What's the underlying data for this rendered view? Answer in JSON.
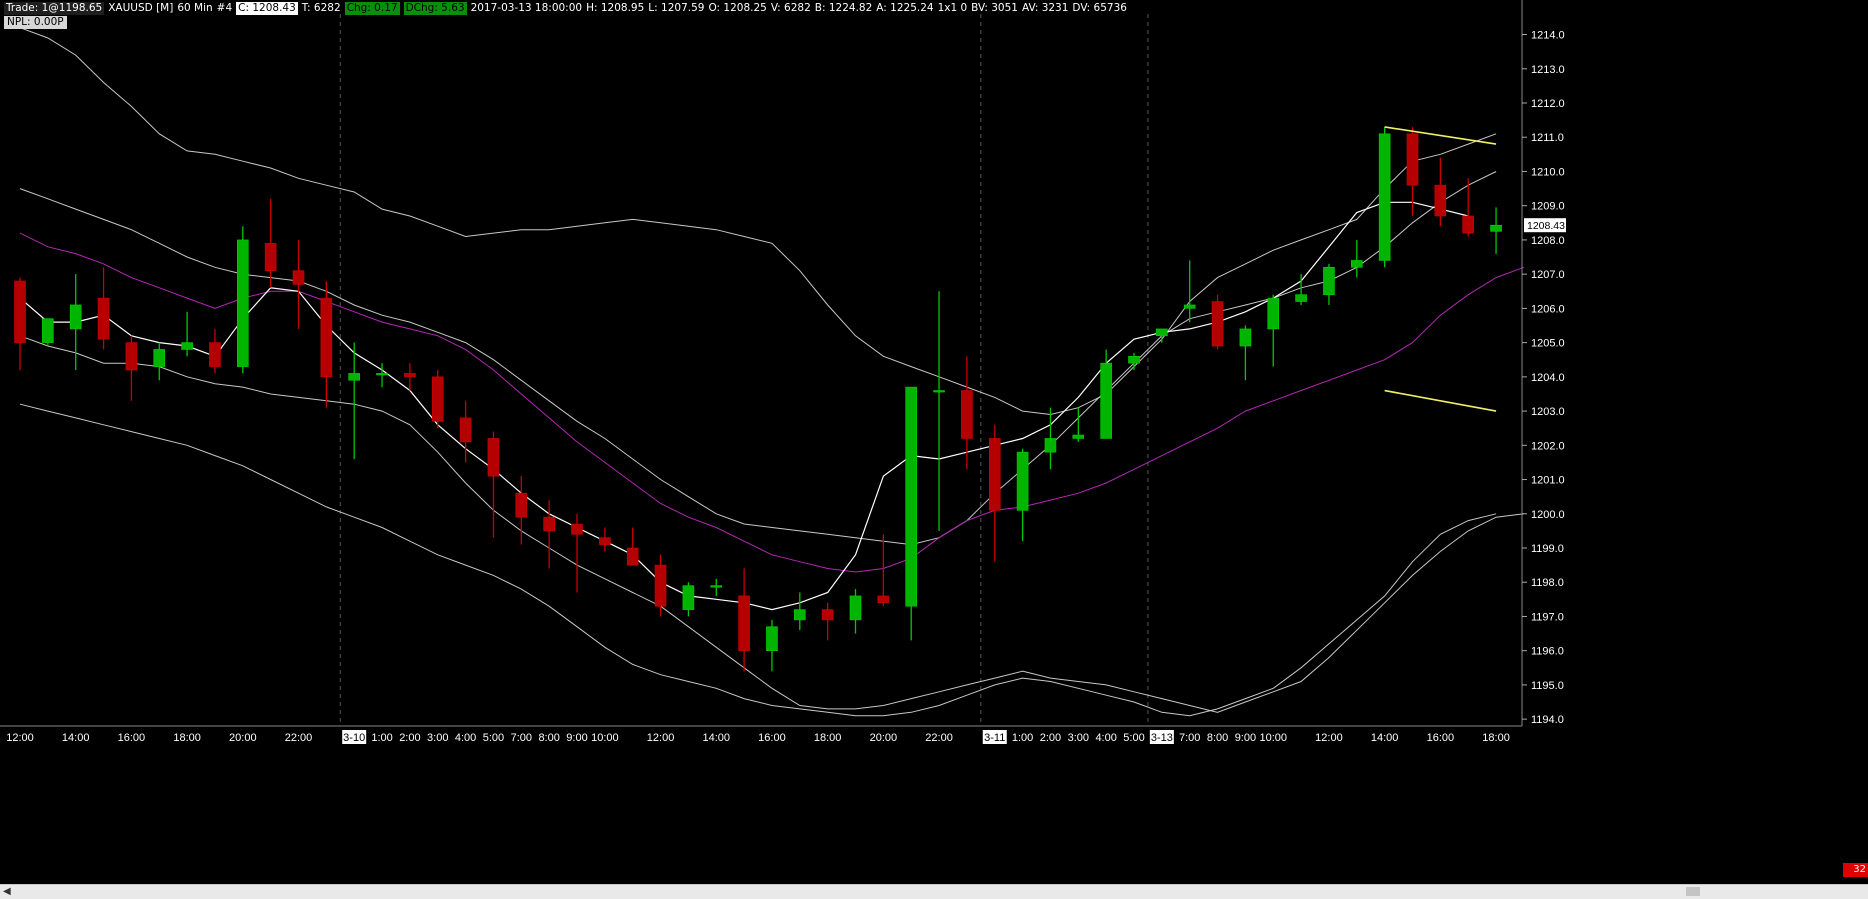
{
  "header": {
    "trade": "Trade: 1@1198.65",
    "symbol": "XAUUSD [M]",
    "interval": "60 Min",
    "bar_no": "#4",
    "close": "C: 1208.43",
    "ticks": "T: 6282",
    "chg": "Chg: 0.17",
    "dchg": "DChg: 5.63",
    "datetime": "2017-03-13 18:00:00",
    "high": "H: 1208.95",
    "low": "L: 1207.59",
    "open": "O: 1208.25",
    "volume": "V: 6282",
    "bid": "B: 1224.82",
    "ask": "A: 1225.24",
    "size": "1x1 0",
    "bv": "BV: 3051",
    "av": "AV: 3231",
    "dv": "DV: 65736"
  },
  "npl": "NPL: 0.00P",
  "corner_badge": "32",
  "colors": {
    "background": "#000000",
    "up": "#00b400",
    "down": "#b40000",
    "wick_up": "#00c800",
    "wick_down": "#c80000",
    "band": "#c8c8c8",
    "mid_line": "#b428b4",
    "trend": "#f0f064",
    "axis_text": "#ffffff",
    "current_price_box": "#ffffff"
  },
  "chart_data": {
    "type": "candlestick",
    "symbol": "XAUUSD",
    "ylim": [
      1193.8,
      1214.6
    ],
    "yticks": [
      1194,
      1195,
      1196,
      1197,
      1198,
      1199,
      1200,
      1201,
      1202,
      1203,
      1204,
      1205,
      1206,
      1207,
      1208,
      1209,
      1210,
      1211,
      1212,
      1213,
      1214
    ],
    "current_price": "1208.43",
    "xticks": [
      "12:00",
      "14:00",
      "16:00",
      "18:00",
      "20:00",
      "22:00",
      "3-10",
      "1:00",
      "2:00",
      "3:00",
      "4:00",
      "5:00",
      "7:00",
      "8:00",
      "9:00",
      "10:00",
      "12:00",
      "14:00",
      "16:00",
      "18:00",
      "20:00",
      "22:00",
      "3-11",
      "1:00",
      "2:00",
      "3:00",
      "4:00",
      "5:00",
      "3-13",
      "7:00",
      "8:00",
      "9:00",
      "10:00",
      "12:00",
      "14:00",
      "16:00",
      "18:00"
    ],
    "date_labels": [
      "3-10",
      "3-11",
      "3-13"
    ],
    "ohlc": [
      [
        1206.8,
        1206.9,
        1204.2,
        1205.0
      ],
      [
        1205.0,
        1205.7,
        1204.9,
        1205.7
      ],
      [
        1205.4,
        1207.0,
        1204.2,
        1206.1
      ],
      [
        1206.3,
        1207.2,
        1204.8,
        1205.1
      ],
      [
        1205.0,
        1205.2,
        1203.3,
        1204.2
      ],
      [
        1204.3,
        1205.0,
        1203.9,
        1204.8
      ],
      [
        1204.8,
        1205.9,
        1204.6,
        1205.0
      ],
      [
        1205.0,
        1205.4,
        1204.1,
        1204.3
      ],
      [
        1204.3,
        1208.4,
        1204.1,
        1208.0
      ],
      [
        1207.9,
        1209.2,
        1206.6,
        1207.1
      ],
      [
        1207.1,
        1208.0,
        1205.4,
        1206.7
      ],
      [
        1206.3,
        1206.8,
        1203.1,
        1204.0
      ],
      [
        1203.9,
        1205.0,
        1201.6,
        1204.1
      ],
      [
        1204.1,
        1204.4,
        1203.7,
        1204.1
      ],
      [
        1204.1,
        1204.4,
        1203.6,
        1204.0
      ],
      [
        1204.0,
        1204.2,
        1202.5,
        1202.7
      ],
      [
        1202.8,
        1203.3,
        1201.5,
        1202.1
      ],
      [
        1202.2,
        1202.4,
        1199.3,
        1201.1
      ],
      [
        1200.6,
        1201.1,
        1199.1,
        1199.9
      ],
      [
        1199.9,
        1200.4,
        1198.4,
        1199.5
      ],
      [
        1199.7,
        1200.0,
        1197.7,
        1199.4
      ],
      [
        1199.3,
        1199.6,
        1198.9,
        1199.1
      ],
      [
        1199.0,
        1199.6,
        1198.6,
        1198.5
      ],
      [
        1198.5,
        1198.8,
        1197.0,
        1197.3
      ],
      [
        1197.2,
        1198.0,
        1197.0,
        1197.9
      ],
      [
        1197.9,
        1198.1,
        1197.6,
        1197.9
      ],
      [
        1197.6,
        1198.4,
        1195.4,
        1196.0
      ],
      [
        1196.0,
        1196.9,
        1195.4,
        1196.7
      ],
      [
        1196.9,
        1197.7,
        1196.6,
        1197.2
      ],
      [
        1197.2,
        1197.4,
        1196.3,
        1196.9
      ],
      [
        1196.9,
        1197.8,
        1196.5,
        1197.6
      ],
      [
        1197.6,
        1199.4,
        1197.3,
        1197.4
      ],
      [
        1197.3,
        1203.7,
        1196.3,
        1203.7
      ],
      [
        1203.6,
        1206.5,
        1199.5,
        1203.6
      ],
      [
        1203.6,
        1204.6,
        1201.3,
        1202.2
      ],
      [
        1202.2,
        1202.6,
        1198.6,
        1200.1
      ],
      [
        1200.1,
        1201.9,
        1199.2,
        1201.8
      ],
      [
        1201.8,
        1203.1,
        1201.3,
        1202.2
      ],
      [
        1202.2,
        1203.1,
        1202.1,
        1202.3
      ],
      [
        1202.2,
        1204.8,
        1202.2,
        1204.4
      ],
      [
        1204.4,
        1204.7,
        1204.2,
        1204.6
      ],
      [
        1205.2,
        1205.4,
        1205.0,
        1205.4
      ],
      [
        1206.0,
        1207.4,
        1205.6,
        1206.1
      ],
      [
        1206.2,
        1206.4,
        1204.8,
        1204.9
      ],
      [
        1204.9,
        1205.5,
        1203.9,
        1205.4
      ],
      [
        1205.4,
        1206.4,
        1204.3,
        1206.3
      ],
      [
        1206.2,
        1207.0,
        1206.1,
        1206.4
      ],
      [
        1206.4,
        1207.3,
        1206.1,
        1207.2
      ],
      [
        1207.2,
        1208.0,
        1206.9,
        1207.4
      ],
      [
        1207.4,
        1211.3,
        1207.2,
        1211.1
      ],
      [
        1211.1,
        1211.3,
        1208.7,
        1209.6
      ],
      [
        1209.6,
        1210.4,
        1208.4,
        1208.7
      ],
      [
        1208.7,
        1209.8,
        1208.1,
        1208.2
      ],
      [
        1208.25,
        1208.95,
        1207.59,
        1208.43
      ]
    ],
    "series": [
      {
        "role": "upper_band_outer",
        "values": [
          1214.2,
          1213.9,
          1213.4,
          1212.6,
          1211.9,
          1211.1,
          1210.6,
          1210.5,
          1210.3,
          1210.1,
          1209.8,
          1209.6,
          1209.4,
          1208.9,
          1208.7,
          1208.4,
          1208.1,
          1208.2,
          1208.3,
          1208.3,
          1208.4,
          1208.5,
          1208.6,
          1208.5,
          1208.4,
          1208.3,
          1208.1,
          1207.9,
          1207.1,
          1206.1,
          1205.2,
          1204.6,
          1204.3,
          1204.0,
          1203.7,
          1203.4,
          1203.0,
          1202.9,
          1203.1,
          1203.5,
          1204.3,
          1205.1,
          1206.2,
          1206.9,
          1207.3,
          1207.7,
          1208.0,
          1208.3,
          1208.6,
          1209.5,
          1210.3,
          1210.5,
          1210.8,
          1211.1
        ]
      },
      {
        "role": "upper_band_inner",
        "values": [
          1209.5,
          1209.2,
          1208.9,
          1208.6,
          1208.3,
          1207.9,
          1207.5,
          1207.2,
          1207.0,
          1206.9,
          1206.8,
          1206.5,
          1206.1,
          1205.8,
          1205.6,
          1205.3,
          1205.0,
          1204.5,
          1203.9,
          1203.3,
          1202.7,
          1202.2,
          1201.6,
          1201.0,
          1200.5,
          1200.0,
          1199.7,
          1199.6,
          1199.5,
          1199.4,
          1199.3,
          1199.2,
          1199.1,
          1199.3,
          1199.8,
          1200.6,
          1201.3,
          1202.0,
          1202.8,
          1203.6,
          1204.4,
          1205.2,
          1205.7,
          1205.9,
          1206.1,
          1206.3,
          1206.6,
          1206.8,
          1207.2,
          1207.8,
          1208.5,
          1209.1,
          1209.6,
          1210.0
        ]
      },
      {
        "role": "mid",
        "color": "#b428b4",
        "values": [
          1208.2,
          1207.8,
          1207.6,
          1207.3,
          1206.9,
          1206.6,
          1206.3,
          1206.0,
          1206.3,
          1206.5,
          1206.5,
          1206.2,
          1205.9,
          1205.6,
          1205.4,
          1205.2,
          1204.8,
          1204.2,
          1203.5,
          1202.8,
          1202.1,
          1201.5,
          1200.9,
          1200.3,
          1199.9,
          1199.6,
          1199.2,
          1198.8,
          1198.6,
          1198.4,
          1198.3,
          1198.4,
          1198.7,
          1199.3,
          1199.8,
          1200.1,
          1200.2,
          1200.4,
          1200.6,
          1200.9,
          1201.3,
          1201.7,
          1202.1,
          1202.5,
          1203.0,
          1203.3,
          1203.6,
          1203.9,
          1204.2,
          1204.5,
          1205.0,
          1205.8,
          1206.4,
          1206.9,
          1207.2
        ]
      },
      {
        "role": "lower_band_inner",
        "values": [
          1205.2,
          1204.9,
          1204.7,
          1204.4,
          1204.4,
          1204.3,
          1204.0,
          1203.8,
          1203.7,
          1203.5,
          1203.4,
          1203.3,
          1203.2,
          1203.0,
          1202.6,
          1201.8,
          1200.9,
          1200.1,
          1199.5,
          1199.0,
          1198.5,
          1198.1,
          1197.7,
          1197.3,
          1196.7,
          1196.1,
          1195.5,
          1194.9,
          1194.4,
          1194.3,
          1194.3,
          1194.4,
          1194.6,
          1194.8,
          1195.0,
          1195.2,
          1195.4,
          1195.2,
          1195.1,
          1195.0,
          1194.8,
          1194.6,
          1194.4,
          1194.2,
          1194.5,
          1194.8,
          1195.1,
          1195.8,
          1196.6,
          1197.4,
          1198.2,
          1198.9,
          1199.5,
          1199.9,
          1200.0
        ]
      },
      {
        "role": "fast_avg",
        "values": [
          1206.3,
          1205.6,
          1205.6,
          1205.8,
          1205.2,
          1205.0,
          1204.9,
          1204.6,
          1205.7,
          1206.6,
          1206.5,
          1205.5,
          1204.7,
          1204.2,
          1203.6,
          1202.6,
          1201.9,
          1201.3,
          1200.6,
          1200.0,
          1199.6,
          1199.2,
          1198.8,
          1198.0,
          1197.6,
          1197.5,
          1197.4,
          1197.2,
          1197.4,
          1197.7,
          1198.8,
          1201.1,
          1201.7,
          1201.6,
          1201.8,
          1202.0,
          1202.2,
          1202.6,
          1203.4,
          1204.4,
          1205.1,
          1205.3,
          1205.4,
          1205.6,
          1205.9,
          1206.3,
          1206.8,
          1207.8,
          1208.8,
          1209.1,
          1209.1,
          1208.9,
          1208.7
        ]
      },
      {
        "role": "lower_band_outer",
        "values": [
          1203.2,
          1203.0,
          1202.8,
          1202.6,
          1202.4,
          1202.2,
          1202.0,
          1201.7,
          1201.4,
          1201.0,
          1200.6,
          1200.2,
          1199.9,
          1199.6,
          1199.2,
          1198.8,
          1198.5,
          1198.2,
          1197.8,
          1197.3,
          1196.7,
          1196.1,
          1195.6,
          1195.3,
          1195.1,
          1194.9,
          1194.6,
          1194.4,
          1194.3,
          1194.2,
          1194.1,
          1194.1,
          1194.2,
          1194.4,
          1194.7,
          1195.0,
          1195.2,
          1195.1,
          1194.9,
          1194.7,
          1194.5,
          1194.2,
          1194.1,
          1194.3,
          1194.6,
          1194.9,
          1195.5,
          1196.2,
          1196.9,
          1197.6,
          1198.6,
          1199.4,
          1199.8,
          1200.0
        ]
      }
    ],
    "trendlines": [
      {
        "from": [
          49,
          1211.3
        ],
        "to": [
          53,
          1210.8
        ]
      },
      {
        "from": [
          49,
          1203.6
        ],
        "to": [
          53,
          1203.0
        ]
      }
    ]
  }
}
